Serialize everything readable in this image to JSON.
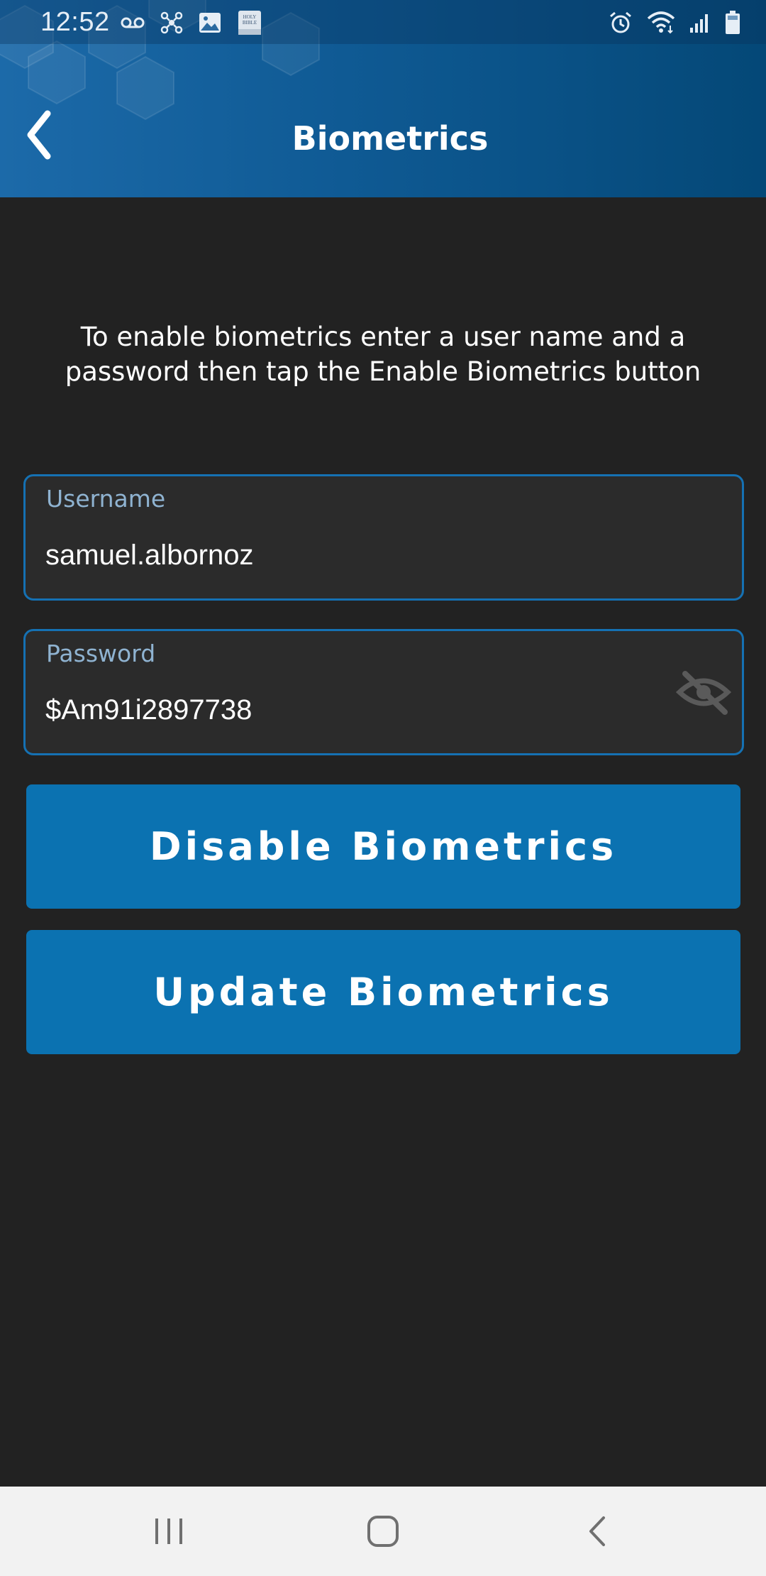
{
  "status_bar": {
    "time": "12:52",
    "left_icons": [
      "voicemail-icon",
      "network-nodes-icon",
      "gallery-icon",
      "bible-app-icon"
    ],
    "right_icons": [
      "alarm-icon",
      "wifi-icon",
      "cell-signal-icon",
      "battery-icon"
    ]
  },
  "app_bar": {
    "title": "Biometrics",
    "back_icon": "chevron-left-icon"
  },
  "instructions": "To enable biometrics enter a user name and a password then tap the Enable Biometrics button",
  "form": {
    "username": {
      "label": "Username",
      "value": "samuel.albornoz"
    },
    "password": {
      "label": "Password",
      "value": "$Am91i2897738",
      "toggle_icon": "eye-off-icon"
    }
  },
  "buttons": {
    "disable": "Disable Biometrics",
    "update": "Update Biometrics"
  },
  "nav_bar": {
    "icons": [
      "recent-apps-icon",
      "home-icon",
      "back-icon"
    ]
  },
  "colors": {
    "header_start": "#1c6aa9",
    "header_end": "#044877",
    "background": "#222222",
    "accent": "#0b72b1",
    "field_border": "#1571b3",
    "field_label": "#8fb3d1"
  }
}
